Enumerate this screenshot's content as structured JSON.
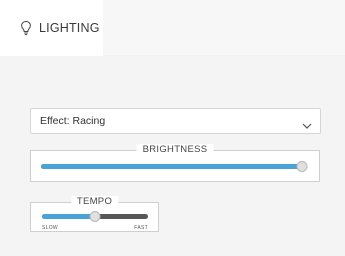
{
  "tabs": [
    {
      "label": "LIGHTING",
      "icon": "lightbulb-icon",
      "active": true
    }
  ],
  "effect_select": {
    "prefix": "Effect:",
    "value": "Racing"
  },
  "brightness": {
    "legend": "BRIGHTNESS",
    "level": 0.98
  },
  "tempo": {
    "legend": "TEMPO",
    "level": 0.5,
    "min_label": "SLOW",
    "max_label": "FAST"
  },
  "colors": {
    "accent": "#4aa3d6",
    "track": "#575757",
    "panel": "#f4f4f4"
  }
}
